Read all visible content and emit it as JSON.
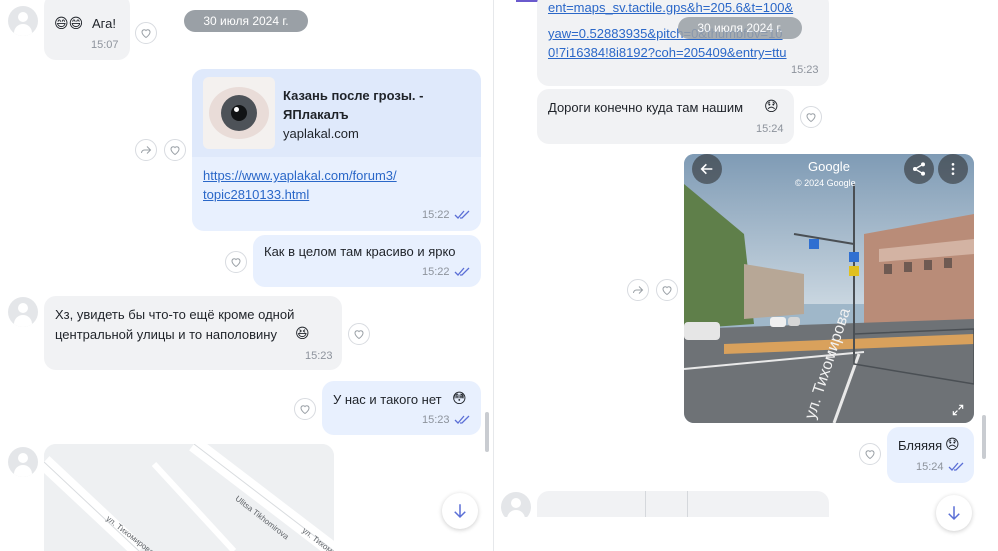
{
  "left_pane": {
    "date_separator": "30 июля 2024 г.",
    "messages": [
      {
        "text": "Ага!",
        "emoji": "😄😄",
        "time": "15:07"
      },
      {
        "link_preview": {
          "title_line1": "Казань после грозы. -",
          "title_line2": "ЯПлакалъ",
          "domain": "yaplakal.com"
        },
        "url_line1": "https://www.yaplakal.com/forum3/",
        "url_line2": "topic2810133.html",
        "time": "15:22"
      },
      {
        "text": "Как в целом там красиво и ярко",
        "time": "15:22"
      },
      {
        "text_line1": "Хз, увидеть бы что-то ещё кроме одной",
        "text_line2": "центральной улицы и то наполовину",
        "emoji": "😆",
        "time": "15:23"
      },
      {
        "text": "У нас и такого нет",
        "emoji": "😳",
        "time": "15:23"
      }
    ],
    "map_labels": [
      "Ulitsa Tikhomirova",
      "ул. Тихомирова",
      "ул. Тихомирова"
    ]
  },
  "right_pane": {
    "date_separator": "30 июля 2024 г.",
    "messages": [
      {
        "url_line1": "ent=maps_sv.tactile.gps&h=205.6&t=100&",
        "url_line2": "yaw=0.52883935&pitch=0&thumbfov=10",
        "url_line3": "0!7i16384!8i8192?coh=205409&entry=ttu",
        "time": "15:23"
      },
      {
        "text": "Дороги конечно куда там нашим",
        "emoji": "😞",
        "time": "15:24"
      },
      {
        "text": "Бляяяя",
        "emoji": "😞",
        "time": "15:24"
      }
    ],
    "street_view": {
      "brand": "Google",
      "copyright": "© 2024 Google",
      "street_label": "ул. Тихомирова"
    }
  },
  "colors": {
    "incoming_bubble": "#f1f2f4",
    "outgoing_bubble": "#e8f0fe",
    "link": "#2a67c8",
    "read_ticks": "#5b6fd6",
    "date_pill": "#9aa0a6"
  },
  "icons": [
    "avatar-placeholder-icon",
    "heart-icon",
    "forward-icon",
    "read-ticks-icon",
    "scroll-down-icon",
    "back-arrow-icon",
    "share-icon",
    "more-icon",
    "expand-icon"
  ]
}
